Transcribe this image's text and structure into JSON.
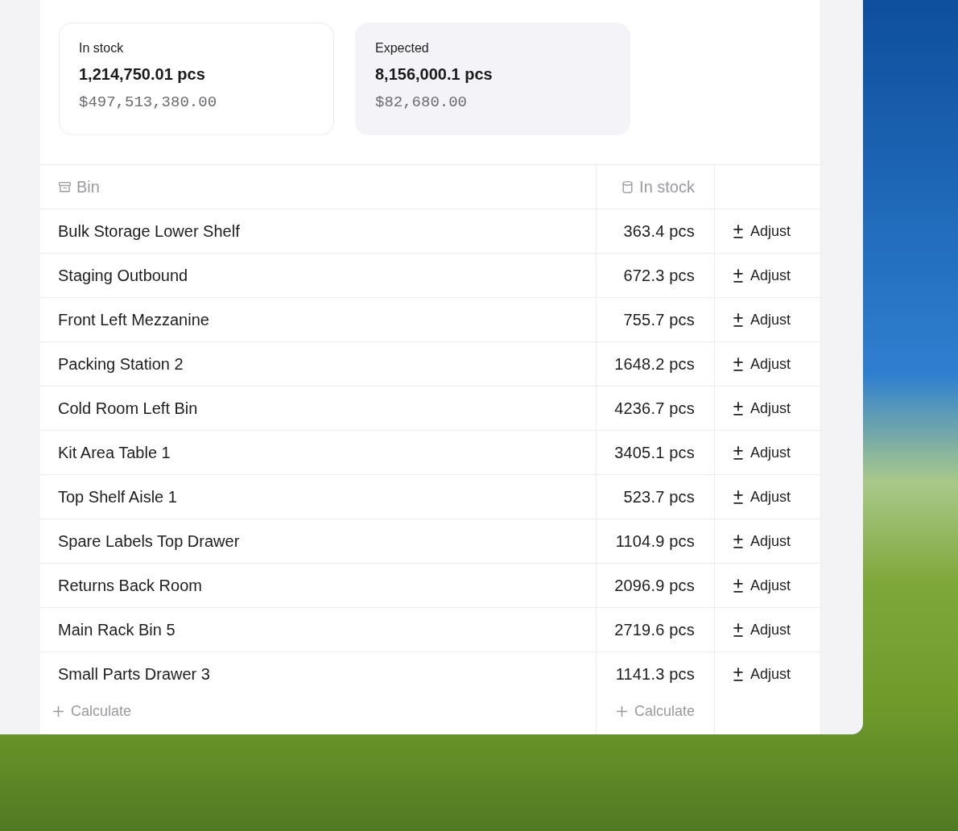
{
  "summary_cards": [
    {
      "label": "In stock",
      "quantity": "1,214,750.01 pcs",
      "value": "$497,513,380.00",
      "selected": false
    },
    {
      "label": "Expected",
      "quantity": "8,156,000.1 pcs",
      "value": "$82,680.00",
      "selected": true
    }
  ],
  "table": {
    "columns": [
      {
        "label": "Bin"
      },
      {
        "label": "In stock"
      }
    ],
    "rows": [
      {
        "bin": "Bulk Storage Lower Shelf",
        "in_stock": "363.4 pcs",
        "action": "Adjust"
      },
      {
        "bin": "Staging Outbound",
        "in_stock": "672.3 pcs",
        "action": "Adjust"
      },
      {
        "bin": "Front Left Mezzanine",
        "in_stock": "755.7 pcs",
        "action": "Adjust"
      },
      {
        "bin": "Packing Station 2",
        "in_stock": "1648.2 pcs",
        "action": "Adjust"
      },
      {
        "bin": "Cold Room Left Bin",
        "in_stock": "4236.7 pcs",
        "action": "Adjust"
      },
      {
        "bin": "Kit Area Table 1",
        "in_stock": "3405.1 pcs",
        "action": "Adjust"
      },
      {
        "bin": "Top Shelf Aisle 1",
        "in_stock": "523.7 pcs",
        "action": "Adjust"
      },
      {
        "bin": "Spare Labels Top Drawer",
        "in_stock": "1104.9 pcs",
        "action": "Adjust"
      },
      {
        "bin": "Returns Back Room",
        "in_stock": "2096.9 pcs",
        "action": "Adjust"
      },
      {
        "bin": "Main Rack Bin 5",
        "in_stock": "2719.6 pcs",
        "action": "Adjust"
      },
      {
        "bin": "Small Parts Drawer 3",
        "in_stock": "1141.3 pcs",
        "action": "Adjust"
      }
    ],
    "footer": [
      "Calculate",
      "Calculate"
    ]
  }
}
